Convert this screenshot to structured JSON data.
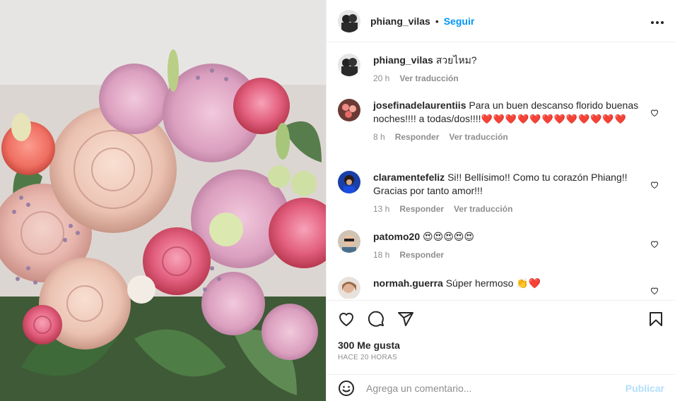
{
  "header": {
    "username": "phiang_vilas",
    "separator": "•",
    "follow_label": "Seguir",
    "more_icon": "more-options-icon"
  },
  "caption": {
    "username": "phiang_vilas",
    "text": "สวยไหม?",
    "time": "20 h",
    "translate": "Ver traducción"
  },
  "comments": [
    {
      "username": "josefinadelaurentiis",
      "text": "Para un buen descanso florido buenas noches!!!! a todas/dos!!!!",
      "hearts": "❤️❤️❤️❤️❤️❤️❤️❤️❤️❤️❤️❤️",
      "time": "8 h",
      "reply": "Responder",
      "translate": "Ver traducción"
    },
    {
      "username": "claramentefeliz",
      "text": "Si!! Bellísimo!! Como tu corazón Phiang!! Gracias por tanto amor!!!",
      "time": "13 h",
      "reply": "Responder",
      "translate": "Ver traducción"
    },
    {
      "username": "patomo20",
      "text": "😍😍😍😍😍",
      "time": "18 h",
      "reply": "Responder"
    },
    {
      "username": "normah.guerra",
      "text": "Súper hermoso 👏❤️"
    }
  ],
  "actions": {
    "icons": [
      "heart-icon",
      "comment-icon",
      "share-icon",
      "bookmark-icon"
    ]
  },
  "likes": "300 Me gusta",
  "posted_ago": "HACE 20 HORAS",
  "add_comment": {
    "placeholder": "Agrega un comentario...",
    "publish_label": "Publicar"
  },
  "colors": {
    "accent": "#0095f6",
    "publish_disabled": "#b2dffc",
    "muted": "#8e8e8e",
    "heart": "#ed1c24"
  }
}
